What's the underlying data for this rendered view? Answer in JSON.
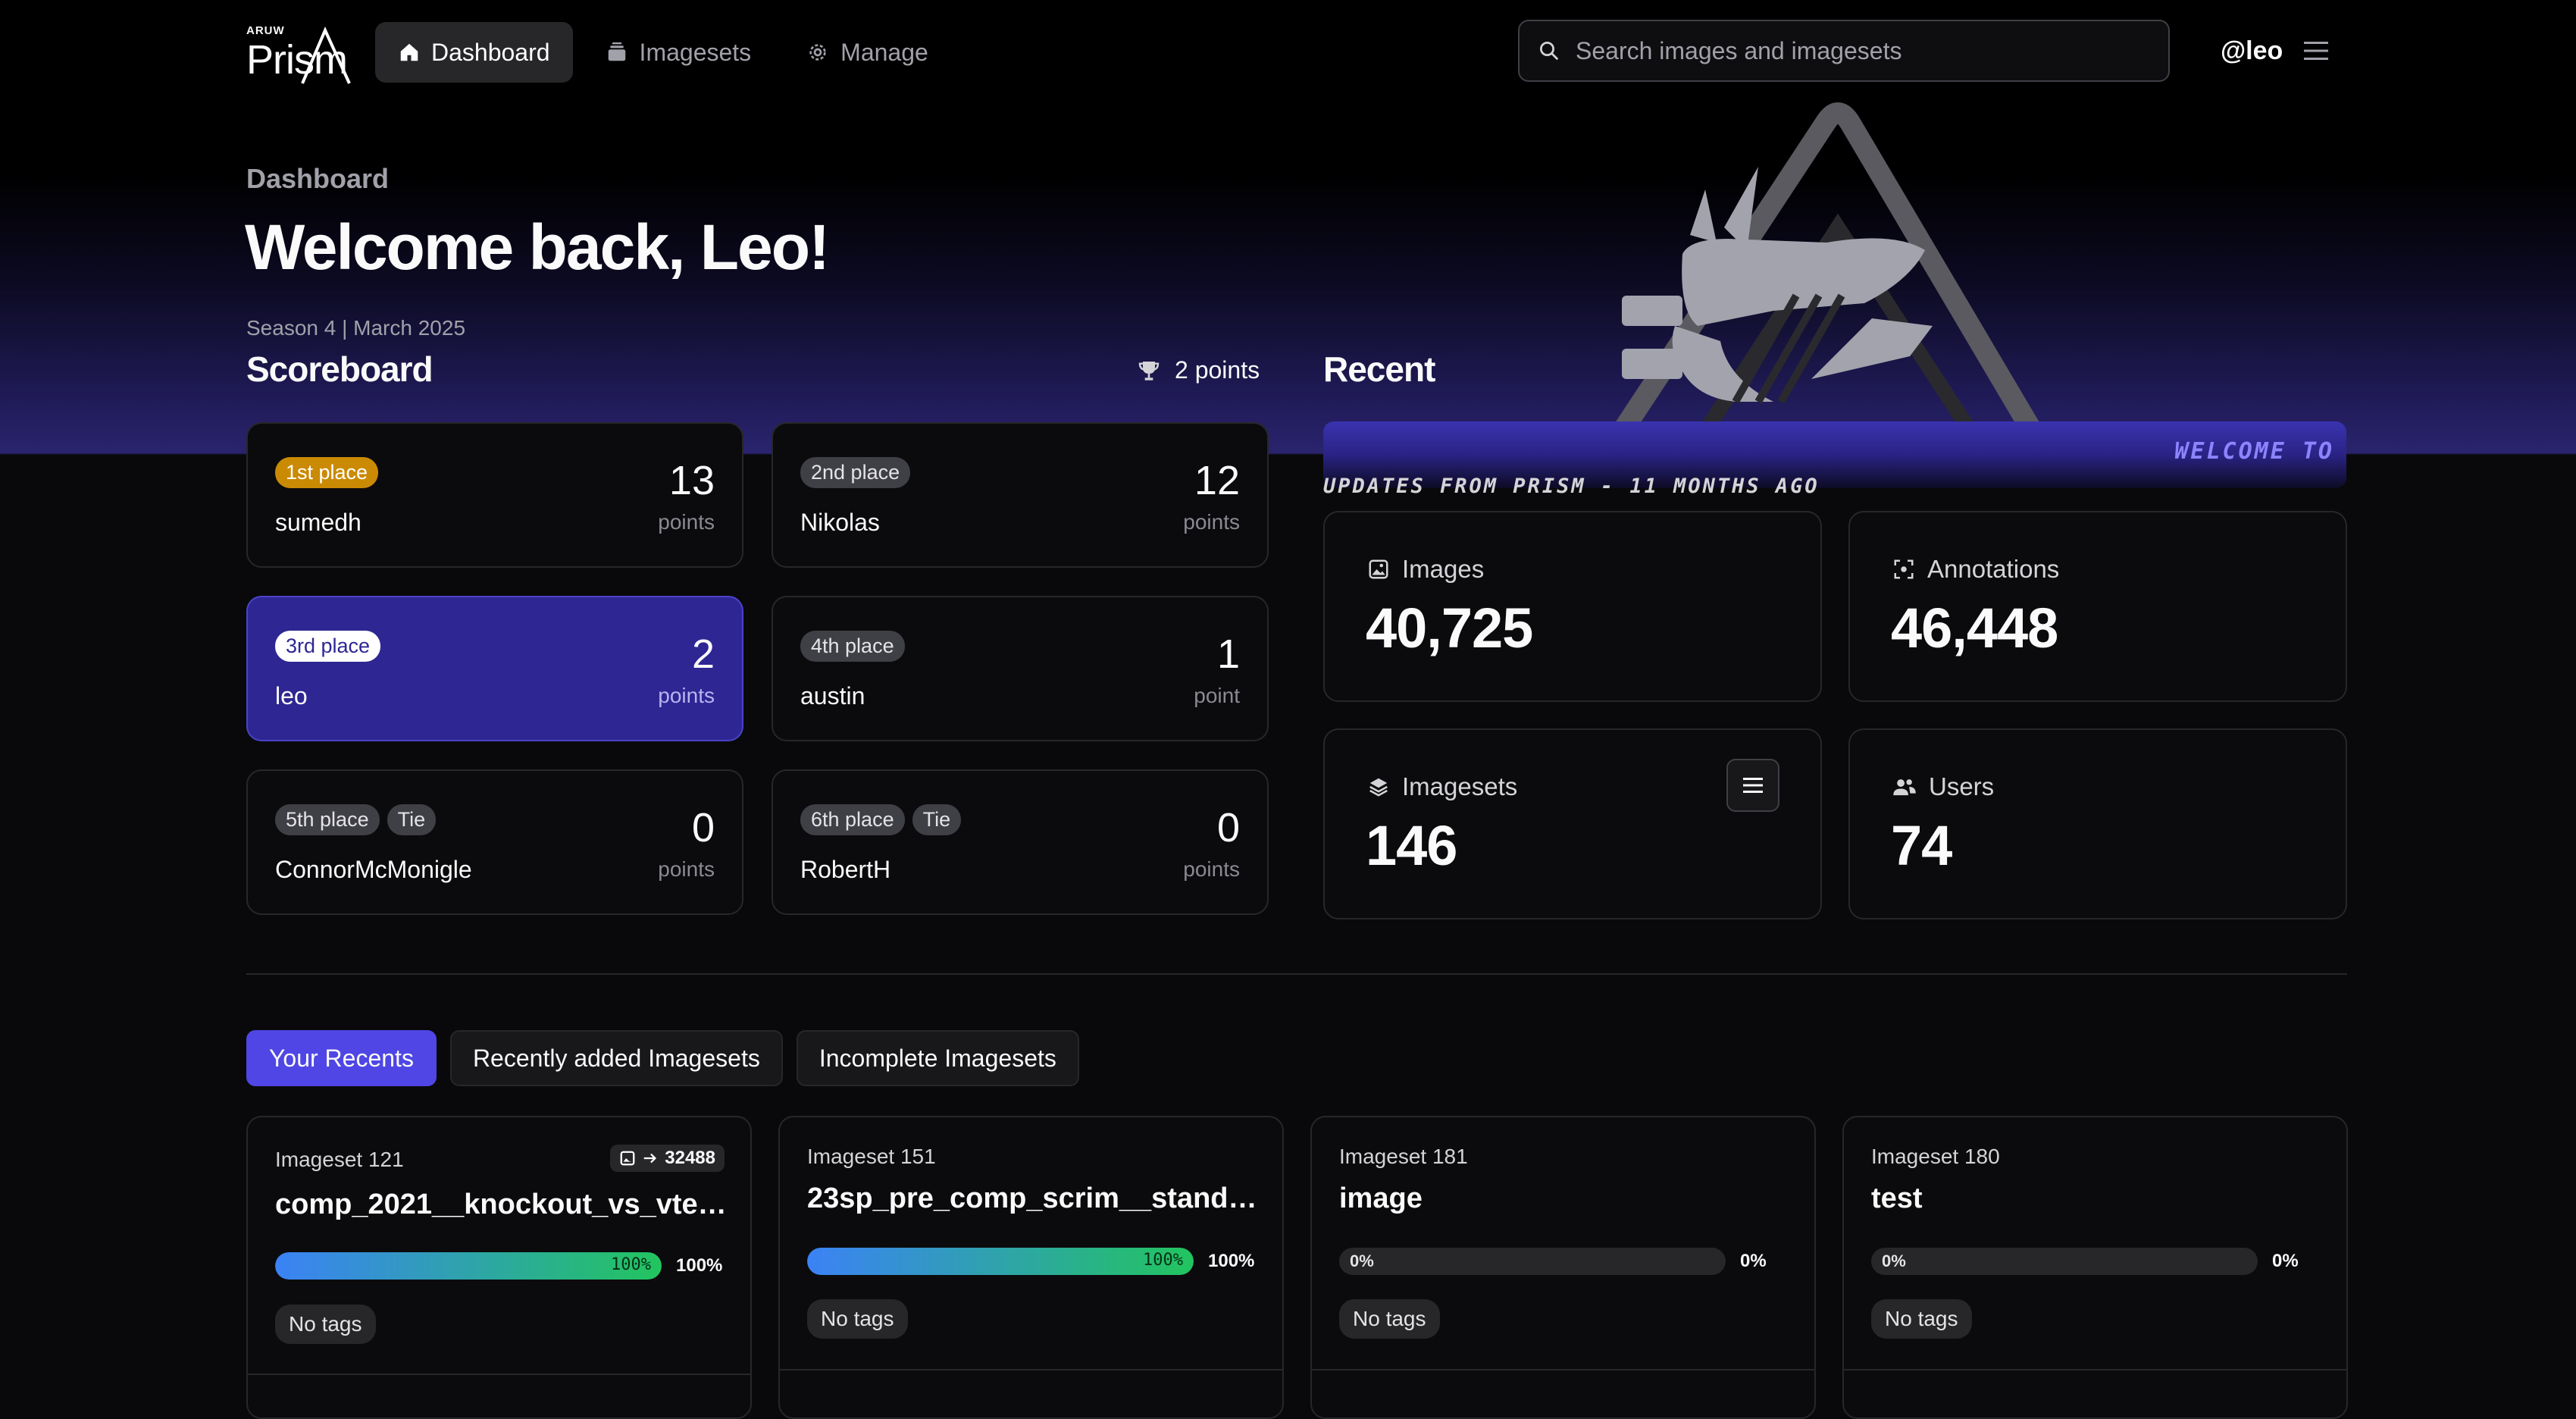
{
  "nav": {
    "logo_small": "ARUW",
    "logo_big": "Prism",
    "items": [
      {
        "label": "Dashboard",
        "icon": "home-icon",
        "active": true
      },
      {
        "label": "Imagesets",
        "icon": "stack-icon",
        "active": false
      },
      {
        "label": "Manage",
        "icon": "gear-icon",
        "active": false
      }
    ],
    "search_placeholder": "Search images and imagesets",
    "user": "@leo"
  },
  "header": {
    "breadcrumb": "Dashboard",
    "welcome": "Welcome back, Leo!",
    "season": "Season 4 | March 2025"
  },
  "scoreboard": {
    "title": "Scoreboard",
    "my_points": "2 points",
    "entries": [
      {
        "place": "1st place",
        "tie": "",
        "name": "sumedh",
        "points": "13",
        "unit": "points"
      },
      {
        "place": "2nd place",
        "tie": "",
        "name": "Nikolas",
        "points": "12",
        "unit": "points"
      },
      {
        "place": "3rd place",
        "tie": "",
        "name": "leo",
        "points": "2",
        "unit": "points"
      },
      {
        "place": "4th place",
        "tie": "",
        "name": "austin",
        "points": "1",
        "unit": "point"
      },
      {
        "place": "5th place",
        "tie": "Tie",
        "name": "ConnorMcMonigle",
        "points": "0",
        "unit": "points"
      },
      {
        "place": "6th place",
        "tie": "Tie",
        "name": "RobertH",
        "points": "0",
        "unit": "points"
      }
    ]
  },
  "recent": {
    "title": "Recent",
    "banner_scroll": "WELCOME TO",
    "banner_text": "UPDATES FROM PRISM - 11 MONTHS AGO"
  },
  "stats": {
    "images": {
      "label": "Images",
      "value": "40,725"
    },
    "annotations": {
      "label": "Annotations",
      "value": "46,448"
    },
    "imagesets": {
      "label": "Imagesets",
      "value": "146"
    },
    "users": {
      "label": "Users",
      "value": "74"
    }
  },
  "tabs": [
    "Your Recents",
    "Recently added Imagesets",
    "Incomplete Imagesets"
  ],
  "imagesets": [
    {
      "id": "Imageset 121",
      "name": "comp_2021__knockout_vs_vtech__...",
      "count": "32488",
      "progress": 1.0,
      "bar_label": "100%",
      "pct": "100%",
      "tags": "No tags"
    },
    {
      "id": "Imageset 151",
      "name": "23sp_pre_comp_scrim__standard_...",
      "count": "",
      "progress": 1.0,
      "bar_label": "100%",
      "pct": "100%",
      "tags": "No tags"
    },
    {
      "id": "Imageset 181",
      "name": "image",
      "count": "",
      "progress": 0,
      "bar_label": "0%",
      "pct": "0%",
      "tags": "No tags"
    },
    {
      "id": "Imageset 180",
      "name": "test",
      "count": "",
      "progress": 0,
      "bar_label": "0%",
      "pct": "0%",
      "tags": "No tags"
    }
  ],
  "colors": {
    "accent": "#4f46e5",
    "my_card": "#2e2693",
    "gold": "#ca8a04",
    "bar_start": "#3b82f6",
    "bar_end": "#22c55e"
  }
}
